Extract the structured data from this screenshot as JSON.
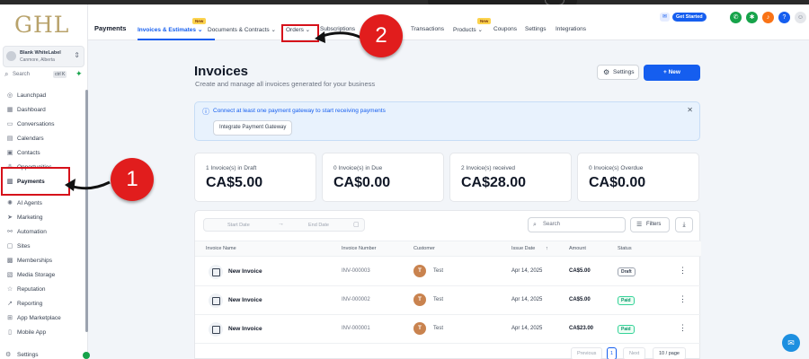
{
  "sidebar": {
    "logo": "GHL",
    "account": {
      "name": "Blank WhiteLabel",
      "location": "Canmore, Alberta"
    },
    "search": {
      "label": "Search",
      "shortcut": "ctrl K"
    },
    "items": [
      {
        "label": "Launchpad",
        "icon": "launchpad-icon"
      },
      {
        "label": "Dashboard",
        "icon": "dashboard-icon"
      },
      {
        "label": "Conversations",
        "icon": "chat-icon"
      },
      {
        "label": "Calendars",
        "icon": "calendar-icon"
      },
      {
        "label": "Contacts",
        "icon": "contacts-icon"
      },
      {
        "label": "Opportunities",
        "icon": "opportunities-icon"
      },
      {
        "label": "Payments",
        "icon": "payments-icon"
      },
      {
        "label": "AI Agents",
        "icon": "ai-agents-icon"
      },
      {
        "label": "Marketing",
        "icon": "marketing-icon"
      },
      {
        "label": "Automation",
        "icon": "automation-icon"
      },
      {
        "label": "Sites",
        "icon": "sites-icon"
      },
      {
        "label": "Memberships",
        "icon": "memberships-icon"
      },
      {
        "label": "Media Storage",
        "icon": "media-icon"
      },
      {
        "label": "Reputation",
        "icon": "star-icon"
      },
      {
        "label": "Reporting",
        "icon": "reporting-icon"
      },
      {
        "label": "App Marketplace",
        "icon": "marketplace-icon"
      },
      {
        "label": "Mobile App",
        "icon": "mobile-icon"
      }
    ],
    "settings_label": "Settings"
  },
  "topbar": {
    "title": "Payments",
    "tabs": [
      {
        "label": "Invoices & Estimates",
        "chevron": true,
        "badge": "New",
        "active": true
      },
      {
        "label": "Documents & Contracts",
        "chevron": true
      },
      {
        "label": "Orders",
        "chevron": true
      },
      {
        "label": "Subscriptions"
      },
      {
        "label": "Transactions"
      },
      {
        "label": "Products",
        "chevron": true,
        "badge": "New"
      },
      {
        "label": "Coupons"
      },
      {
        "label": "Settings"
      },
      {
        "label": "Integrations"
      }
    ],
    "get_started": "Get Started",
    "colors": {
      "accent": "#155eef",
      "phone": "#16a34a",
      "megaphone": "#16a34a",
      "bell": "#f97316",
      "help": "#155eef"
    }
  },
  "annotations": {
    "step1": "1",
    "step2": "2",
    "color": "#e11d1d"
  },
  "main": {
    "title": "Invoices",
    "subtitle": "Create and manage all invoices generated for your business",
    "settings_btn": "Settings",
    "new_btn": "+ New",
    "alert": {
      "text": "Connect at least one payment gateway to start receiving payments",
      "button": "Integrate Payment Gateway"
    },
    "cards": [
      {
        "label": "1 Invoice(s) in Draft",
        "value": "CA$5.00"
      },
      {
        "label": "0 Invoice(s) in Due",
        "value": "CA$0.00"
      },
      {
        "label": "2 Invoice(s) received",
        "value": "CA$28.00"
      },
      {
        "label": "0 Invoice(s) Overdue",
        "value": "CA$0.00"
      }
    ],
    "filters": {
      "start_date": "Start Date",
      "end_date": "End Date",
      "search_placeholder": "Search",
      "filters_btn": "Filters"
    },
    "table": {
      "columns": [
        "Invoice Name",
        "Invoice Number",
        "Customer",
        "Issue Date",
        "Amount",
        "Status"
      ],
      "rows": [
        {
          "name": "New Invoice",
          "number": "INV-000003",
          "avatar": "T",
          "customer": "Test",
          "date": "Apr 14, 2025",
          "amount": "CA$5.00",
          "status": "Draft"
        },
        {
          "name": "New Invoice",
          "number": "INV-000002",
          "avatar": "T",
          "customer": "Test",
          "date": "Apr 14, 2025",
          "amount": "CA$5.00",
          "status": "Paid"
        },
        {
          "name": "New Invoice",
          "number": "INV-000001",
          "avatar": "T",
          "customer": "Test",
          "date": "Apr 14, 2025",
          "amount": "CA$23.00",
          "status": "Paid"
        }
      ]
    },
    "pager": {
      "previous": "Previous",
      "page": "1",
      "next": "Next",
      "per_page": "10 / page"
    }
  }
}
